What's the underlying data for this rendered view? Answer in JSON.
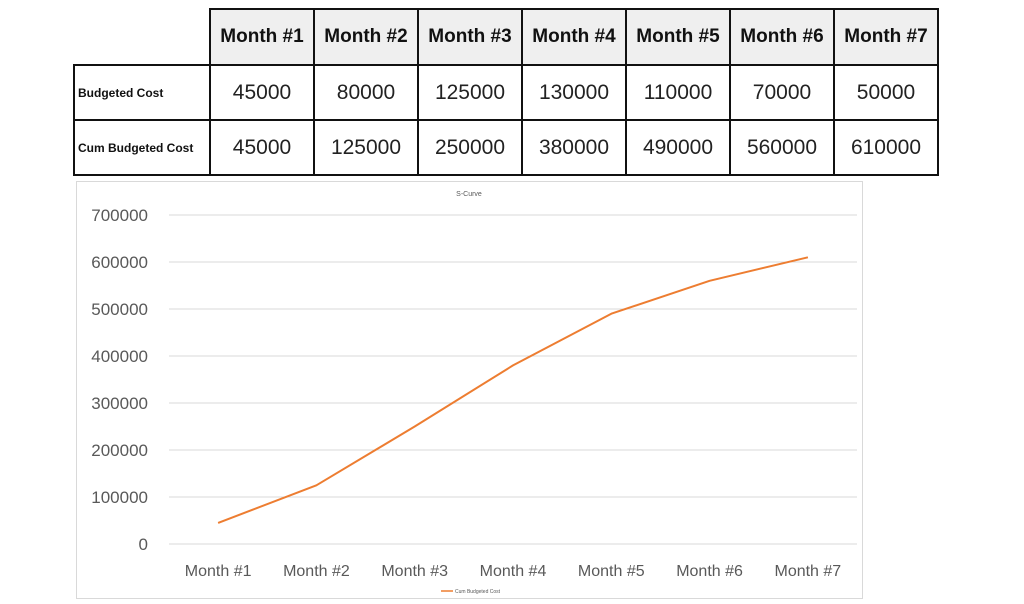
{
  "table": {
    "headers": [
      "Month #1",
      "Month #2",
      "Month #3",
      "Month #4",
      "Month #5",
      "Month #6",
      "Month #7"
    ],
    "rows": [
      {
        "label": "Budgeted Cost",
        "values": [
          "45000",
          "80000",
          "125000",
          "130000",
          "110000",
          "70000",
          "50000"
        ]
      },
      {
        "label": "Cum Budgeted Cost",
        "values": [
          "45000",
          "125000",
          "250000",
          "380000",
          "490000",
          "560000",
          "610000"
        ]
      }
    ]
  },
  "chart_data": {
    "type": "line",
    "title": "S-Curve",
    "categories": [
      "Month #1",
      "Month #2",
      "Month #3",
      "Month #4",
      "Month #5",
      "Month #6",
      "Month #7"
    ],
    "series": [
      {
        "name": "Cum Budgeted Cost",
        "color": "#ed7d31",
        "values": [
          45000,
          125000,
          250000,
          380000,
          490000,
          560000,
          610000
        ]
      }
    ],
    "xlabel": "",
    "ylabel": "",
    "ylim": [
      0,
      700000
    ],
    "yticks": [
      0,
      100000,
      200000,
      300000,
      400000,
      500000,
      600000,
      700000
    ],
    "ytick_labels": [
      "0",
      "100000",
      "200000",
      "300000",
      "400000",
      "500000",
      "600000",
      "700000"
    ],
    "grid": true,
    "legend": "bottom"
  }
}
